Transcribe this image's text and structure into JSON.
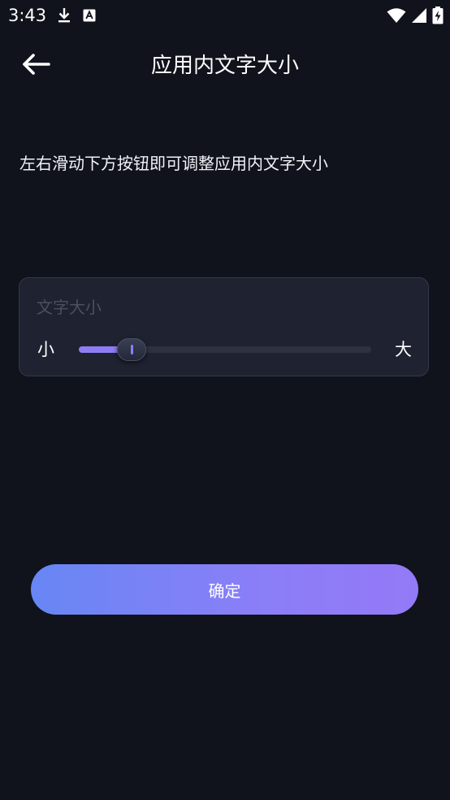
{
  "status_bar": {
    "time": "3:43",
    "left_icons": [
      "download-icon",
      "a-box-icon"
    ],
    "right_icons": [
      "wifi-icon",
      "signal-icon",
      "battery-charging-icon"
    ]
  },
  "app_bar": {
    "title": "应用内文字大小",
    "back_icon": "arrow-left-icon"
  },
  "instruction": "左右滑动下方按钮即可调整应用内文字大小",
  "font_size_card": {
    "label": "文字大小",
    "min_label": "小",
    "max_label": "大",
    "slider_value": 0.18
  },
  "confirm_button": {
    "label": "确定"
  },
  "colors": {
    "background": "#10131c",
    "card": "#1f2230",
    "accent": "#8f7cf5",
    "button_gradient_start": "#6787f4",
    "button_gradient_end": "#9479f7"
  }
}
